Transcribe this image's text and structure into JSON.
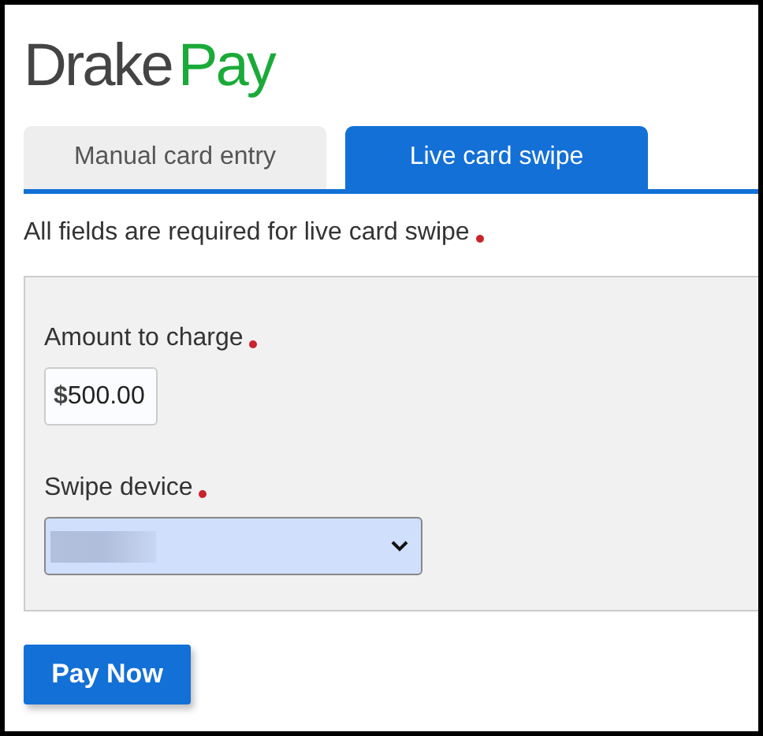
{
  "logo": {
    "first": "Drake",
    "second": "Pay"
  },
  "tabs": [
    {
      "label": "Manual card entry",
      "selected": false
    },
    {
      "label": "Live card swipe",
      "selected": true
    }
  ],
  "notice": {
    "text": "All fields are required for live card swipe",
    "required": true
  },
  "fields": [
    {
      "kind": "amount",
      "label": "Amount to charge",
      "required": true,
      "prefix": "$",
      "value": "500.00"
    },
    {
      "kind": "select",
      "label": "Swipe device",
      "required": true,
      "redacted": true
    }
  ],
  "buttons": [
    {
      "label": "Pay Now"
    }
  ]
}
